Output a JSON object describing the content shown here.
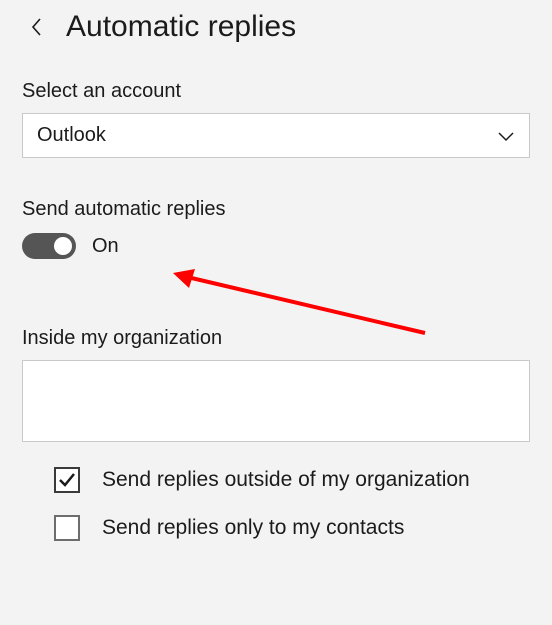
{
  "header": {
    "title": "Automatic replies"
  },
  "account": {
    "label": "Select an account",
    "selected": "Outlook"
  },
  "autoReply": {
    "label": "Send automatic replies",
    "stateText": "On"
  },
  "inside": {
    "label": "Inside my organization",
    "value": ""
  },
  "outside": {
    "sendOutsideLabel": "Send replies outside of my organization",
    "contactsOnlyLabel": "Send replies only to my contacts"
  }
}
